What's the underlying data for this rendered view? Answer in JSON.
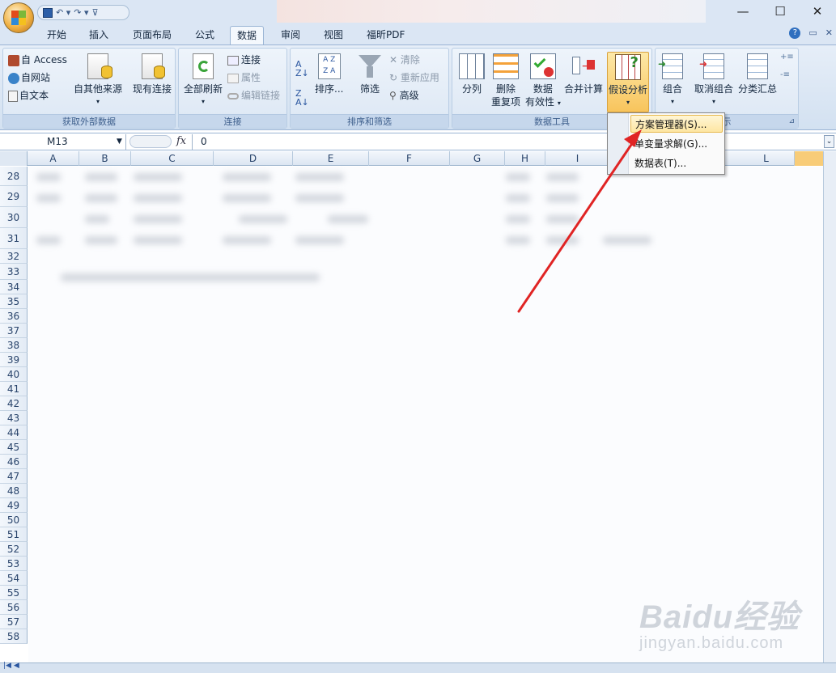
{
  "qat": {
    "save_icon": "save-icon",
    "undo_icon": "undo-icon",
    "redo_icon": "redo-icon",
    "customize_icon": "customize-qat-icon"
  },
  "window": {
    "minimize": "—",
    "maximize": "☐",
    "close": "✕"
  },
  "tabs": [
    "开始",
    "插入",
    "页面布局",
    "公式",
    "数据",
    "审阅",
    "视图",
    "福昕PDF"
  ],
  "active_tab": "数据",
  "ribbon": {
    "get_external": {
      "label": "获取外部数据",
      "access": "自 Access",
      "web": "自网站",
      "text": "自文本",
      "other": "自其他来源",
      "existing": "现有连接"
    },
    "connections": {
      "label": "连接",
      "refresh_all": "全部刷新",
      "connections": "连接",
      "properties": "属性",
      "edit_links": "编辑链接"
    },
    "sort_filter": {
      "label": "排序和筛选",
      "sort": "排序...",
      "filter": "筛选",
      "clear": "清除",
      "reapply": "重新应用",
      "advanced": "高级"
    },
    "data_tools": {
      "label": "数据工具",
      "text_to_columns": "分列",
      "remove_dup_1": "删除",
      "remove_dup_2": "重复项",
      "validation_1": "数据",
      "validation_2": "有效性",
      "consolidate": "合并计算",
      "whatif": "假设分析"
    },
    "outline": {
      "label": "分级显示",
      "label_visible": "示",
      "group": "组合",
      "ungroup": "取消组合",
      "subtotal": "分类汇总"
    }
  },
  "formula_bar": {
    "name_box": "M13",
    "fx": "fx",
    "value": "0"
  },
  "columns": [
    "A",
    "B",
    "C",
    "D",
    "E",
    "F",
    "G",
    "H",
    "I",
    "L"
  ],
  "rows": [
    "28",
    "29",
    "30",
    "31",
    "32",
    "33",
    "34",
    "35",
    "36",
    "37",
    "38",
    "39",
    "40",
    "41",
    "42",
    "43",
    "44",
    "45",
    "46",
    "47",
    "48",
    "49",
    "50",
    "51",
    "52",
    "53",
    "54",
    "55",
    "56",
    "57",
    "58"
  ],
  "dropdown": {
    "items": [
      "方案管理器(S)...",
      "单变量求解(G)...",
      "数据表(T)..."
    ]
  },
  "watermark": {
    "main": "Baidu经验",
    "sub": "jingyan.baidu.com"
  },
  "colors": {
    "accent": "#f8cc78",
    "arrow": "#e02424",
    "ribbon": "#dbe6f4"
  }
}
